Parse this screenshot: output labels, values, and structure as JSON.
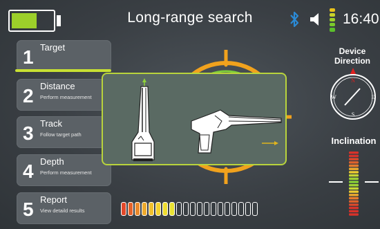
{
  "header": {
    "title": "Long-range search",
    "time": "16:40",
    "battery_level": 0.6
  },
  "sidebar": {
    "items": [
      {
        "num": "1",
        "label": "Target",
        "sub": ""
      },
      {
        "num": "2",
        "label": "Distance",
        "sub": "Perform measurement"
      },
      {
        "num": "3",
        "label": "Track",
        "sub": "Follow target path"
      },
      {
        "num": "4",
        "label": "Depth",
        "sub": "Perform measurement"
      },
      {
        "num": "5",
        "label": "Report",
        "sub": "View detaild results"
      }
    ],
    "active_index": 0
  },
  "right_panel": {
    "direction_label_line1": "Device",
    "direction_label_line2": "Direction",
    "compass": {
      "n": "N",
      "e": "E",
      "s": "S",
      "w": "W"
    },
    "inclination_label": "Inclination"
  },
  "signal_meter": {
    "total_segments": 20,
    "filled_segments": 8
  },
  "colors": {
    "accent": "#c8e033",
    "battery": "#9ccf2a",
    "bluetooth": "#2b8ad6",
    "radar_orange": "#f1a21d",
    "radar_green": "#7fcf3a"
  },
  "icons": {
    "battery": "battery-icon",
    "bluetooth": "bluetooth-icon",
    "speaker": "speaker-icon",
    "signal": "signal-strength-icon"
  }
}
